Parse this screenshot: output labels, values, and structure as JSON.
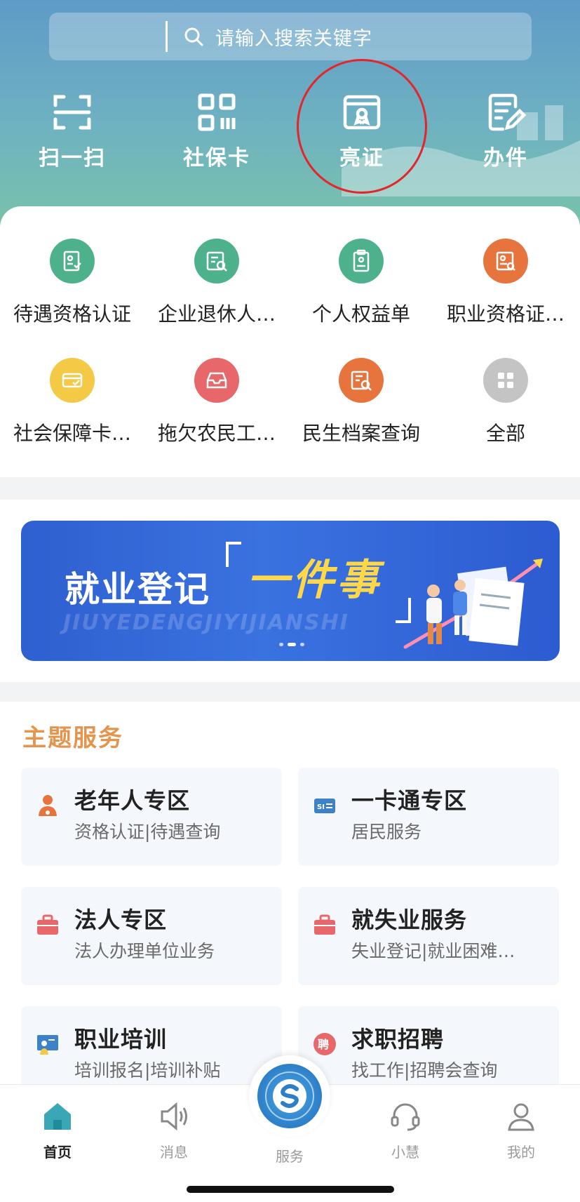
{
  "search": {
    "placeholder": "请输入搜索关键字"
  },
  "quick_actions": [
    {
      "label": "扫一扫",
      "icon": "scan-icon"
    },
    {
      "label": "社保卡",
      "icon": "qrcode-icon"
    },
    {
      "label": "亮证",
      "icon": "certificate-icon"
    },
    {
      "label": "办件",
      "icon": "edit-document-icon"
    }
  ],
  "services": [
    {
      "label": "待遇资格认证",
      "icon": "certification-icon",
      "color": "#4db18c"
    },
    {
      "label": "企业退休人…",
      "icon": "retiree-search-icon",
      "color": "#4db18c"
    },
    {
      "label": "个人权益单",
      "icon": "clipboard-icon",
      "color": "#4db18c"
    },
    {
      "label": "职业资格证…",
      "icon": "qualification-icon",
      "color": "#e6743c"
    },
    {
      "label": "社会保障卡…",
      "icon": "card-check-icon",
      "color": "#f3c945"
    },
    {
      "label": "拖欠农民工…",
      "icon": "inbox-icon",
      "color": "#e8676a"
    },
    {
      "label": "民生档案查询",
      "icon": "archive-search-icon",
      "color": "#e6743c"
    },
    {
      "label": "全部",
      "icon": "grid-icon",
      "color": "#c4c4c4"
    }
  ],
  "banner": {
    "title": "就业登记",
    "highlight": "一件事",
    "pinyin": "JIUYEDENGJIYIJIANSHI"
  },
  "themes": {
    "title": "主题服务",
    "items": [
      {
        "name": "老年人专区",
        "sub": "资格认证|待遇查询",
        "icon": "elderly-icon",
        "color": "#e6743c"
      },
      {
        "name": "一卡通专区",
        "sub": "居民服务",
        "icon": "si-card-icon",
        "color": "#3d82c9"
      },
      {
        "name": "法人专区",
        "sub": "法人办理单位业务",
        "icon": "briefcase-icon",
        "color": "#e8676a"
      },
      {
        "name": "就失业服务",
        "sub": "失业登记|就业困难…",
        "icon": "briefcase-icon",
        "color": "#e8676a"
      },
      {
        "name": "职业培训",
        "sub": "培训报名|培训补贴",
        "icon": "training-icon",
        "color": "#3d82c9"
      },
      {
        "name": "求职招聘",
        "sub": "找工作|招聘会查询",
        "icon": "recruit-icon",
        "color": "#e8676a"
      }
    ]
  },
  "tabbar": [
    {
      "label": "首页",
      "icon": "home-icon"
    },
    {
      "label": "消息",
      "icon": "speaker-icon"
    },
    {
      "label": "服务",
      "icon": "service-logo-icon"
    },
    {
      "label": "小慧",
      "icon": "headset-icon"
    },
    {
      "label": "我的",
      "icon": "user-icon"
    }
  ],
  "colors": {
    "header_start": "#5f9bc7",
    "header_end": "#79c3a8",
    "theme_title": "#e5944d",
    "banner": "#3a72e0",
    "highlight": "#ffd84a",
    "circle_mark": "#e3262b"
  }
}
